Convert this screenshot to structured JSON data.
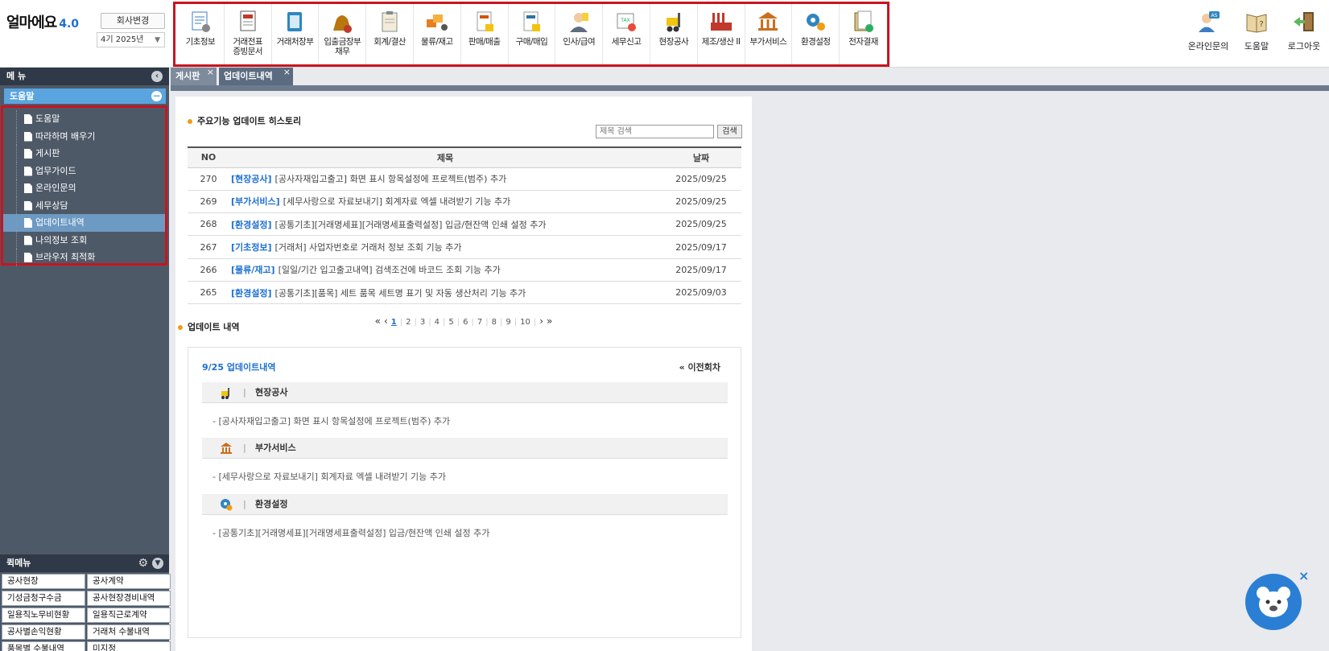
{
  "app": {
    "logo_text": "얼마에요",
    "version": "4.0",
    "company_button": "회사변경",
    "period": "4기 2025년"
  },
  "top_menu": [
    {
      "id": "basic",
      "label": "기초정보",
      "icon": "list-gear-icon",
      "color": "#3b7dc4"
    },
    {
      "id": "voucher",
      "label": "거래전표\n증빙문서",
      "icon": "voucher-icon",
      "color": "#c0392b"
    },
    {
      "id": "ledger",
      "label": "거래처장부",
      "icon": "ledger-book-icon",
      "color": "#2e86c1"
    },
    {
      "id": "cash",
      "label": "입출금장부\n채무",
      "icon": "money-bag-icon",
      "color": "#b9770e"
    },
    {
      "id": "account",
      "label": "회계/결산",
      "icon": "clipboard-icon",
      "color": "#7f8c8d"
    },
    {
      "id": "logistics",
      "label": "물류/재고",
      "icon": "boxes-icon",
      "color": "#e67e22"
    },
    {
      "id": "sales",
      "label": "판매/매출",
      "icon": "invoice-red-icon",
      "color": "#d35400"
    },
    {
      "id": "purchase",
      "label": "구매/매입",
      "icon": "invoice-blue-icon",
      "color": "#2874a6"
    },
    {
      "id": "hr",
      "label": "인사/급여",
      "icon": "person-icon",
      "color": "#5d6d7e"
    },
    {
      "id": "tax",
      "label": "세무신고",
      "icon": "tax-icon",
      "color": "#27ae60"
    },
    {
      "id": "site",
      "label": "현장공사",
      "icon": "forklift-icon",
      "color": "#f1c40f"
    },
    {
      "id": "manufacture",
      "label": "제조/생산 II",
      "icon": "factory-icon",
      "color": "#c0392b"
    },
    {
      "id": "addon",
      "label": "부가서비스",
      "icon": "bank-icon",
      "color": "#ca6f1e"
    },
    {
      "id": "settings",
      "label": "환경설정",
      "icon": "gears-icon",
      "color": "#2e86c1"
    },
    {
      "id": "epay",
      "label": "전자결재",
      "icon": "approval-icon",
      "color": "#7d6608"
    }
  ],
  "top_right": [
    {
      "id": "inquiry",
      "label": "온라인문의",
      "icon": "support-agent-icon"
    },
    {
      "id": "help",
      "label": "도움말",
      "icon": "help-book-icon"
    },
    {
      "id": "logout",
      "label": "로그아웃",
      "icon": "logout-door-icon"
    }
  ],
  "sidebar": {
    "title": "메 뉴",
    "group": "도움말",
    "items": [
      {
        "label": "도움말",
        "active": false
      },
      {
        "label": "따라하며 배우기",
        "active": false
      },
      {
        "label": "게시판",
        "active": false
      },
      {
        "label": "업무가이드",
        "active": false
      },
      {
        "label": "온라인문의",
        "active": false
      },
      {
        "label": "세무상담",
        "active": false
      },
      {
        "label": "업데이트내역",
        "active": true
      },
      {
        "label": "나의정보 조회",
        "active": false
      },
      {
        "label": "브라우저 최적화",
        "active": false
      }
    ]
  },
  "quick_menu": {
    "title": "퀵메뉴",
    "items": [
      "공사현장",
      "공사계약",
      "기성금청구수금",
      "공사현장경비내역",
      "일용직노무비현황",
      "일용직근로계약",
      "공사별손익현황",
      "거래처 수불내역",
      "품목별 수불내역",
      "미지정"
    ]
  },
  "tabs": [
    {
      "label": "게시판",
      "close": "×"
    },
    {
      "label": "업데이트내역",
      "close": "×"
    }
  ],
  "history": {
    "title": "주요기능 업데이트 히스토리",
    "search_placeholder": "제목 검색",
    "search_button": "검색",
    "columns": [
      "NO",
      "제목",
      "날짜"
    ],
    "rows": [
      {
        "no": "270",
        "cat": "[현장공사]",
        "title": "[공사자재입고출고] 화면 표시 항목설정에 프로젝트(범주) 추가",
        "date": "2025/09/25"
      },
      {
        "no": "269",
        "cat": "[부가서비스]",
        "title": "[세무사랑으로 자료보내기] 회계자료 엑셀 내려받기 기능 추가",
        "date": "2025/09/25"
      },
      {
        "no": "268",
        "cat": "[환경설정]",
        "title": "[공통기초][거래명세표][거래명세표출력설정] 입금/현잔액 인쇄 설정 추가",
        "date": "2025/09/25"
      },
      {
        "no": "267",
        "cat": "[기초정보]",
        "title": "[거래처] 사업자번호로 거래처 정보 조회 기능 추가",
        "date": "2025/09/17"
      },
      {
        "no": "266",
        "cat": "[물류/재고]",
        "title": "[일일/기간 입고출고내역] 검색조건에 바코드 조회 기능 추가",
        "date": "2025/09/17"
      },
      {
        "no": "265",
        "cat": "[환경설정]",
        "title": "[공통기초][품목] 세트 품목 세트명 표기 및 자동 생산처리 기능 추가",
        "date": "2025/09/03"
      }
    ],
    "pager": {
      "first": "«",
      "prev": "‹",
      "pages": [
        "1",
        "2",
        "3",
        "4",
        "5",
        "6",
        "7",
        "8",
        "9",
        "10"
      ],
      "current": "1",
      "next": "›",
      "last": "»"
    }
  },
  "updates": {
    "title": "업데이트 내역",
    "heading": "9/25 업데이트내역",
    "prev_label": "« 이전회차",
    "sections": [
      {
        "category": "현장공사",
        "icon": "forklift-icon",
        "desc": "- [공사자재입고출고] 화면 표시 항목설정에 프로젝트(범주) 추가"
      },
      {
        "category": "부가서비스",
        "icon": "bank-icon",
        "desc": "- [세무사랑으로 자료보내기] 회계자료 엑셀 내려받기 기능 추가"
      },
      {
        "category": "환경설정",
        "icon": "gears-icon",
        "desc": "- [공통기초][거래명세표][거래명세표출력설정] 입금/현잔액 인쇄 설정 추가"
      }
    ]
  },
  "mascot": {
    "icon": "bear-mascot-icon",
    "close": "×",
    "color": "#2a7fd4"
  },
  "colors": {
    "highlight": "#c8141e",
    "accent": "#1d6fd1",
    "sidebar": "#4e5968",
    "active_item": "#6d9ac2"
  }
}
